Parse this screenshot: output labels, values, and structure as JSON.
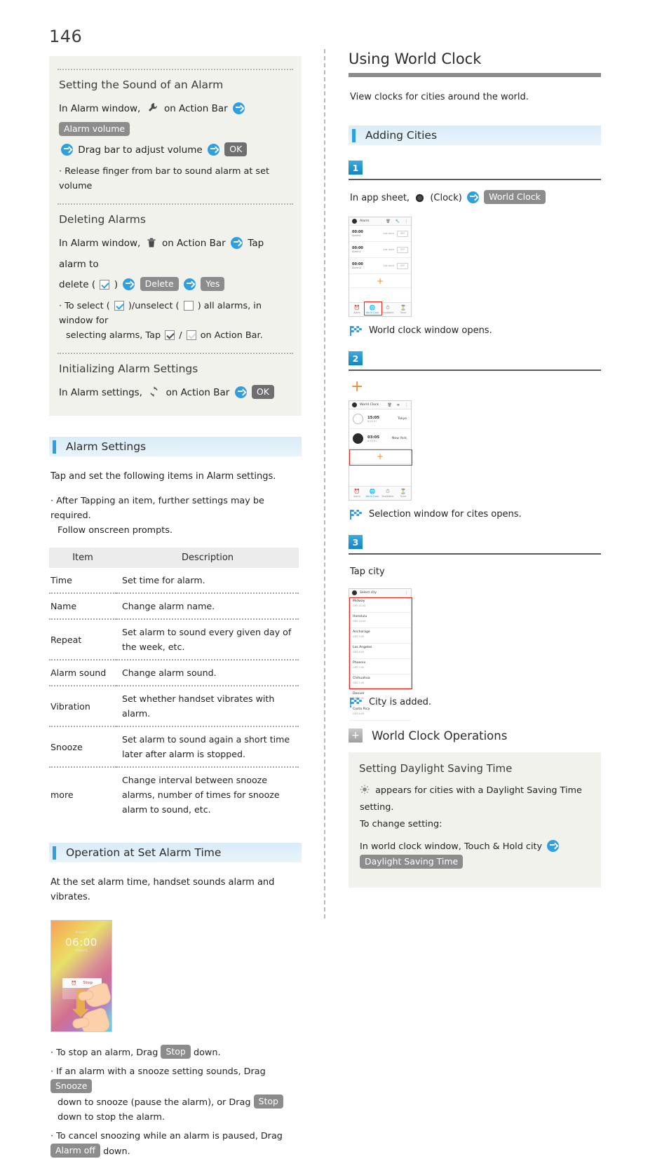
{
  "page_number": "146",
  "left": {
    "tip_sections": [
      {
        "heading": "Setting the Sound of an Alarm",
        "line1_a": "In Alarm window,",
        "line1_icon": "wrench-icon",
        "line1_b": "on Action Bar",
        "chip1": "Alarm volume",
        "line2": "Drag bar to adjust volume",
        "chip2": "OK",
        "bullet": "Release finger from bar to sound alarm at set volume"
      },
      {
        "heading": "Deleting Alarms",
        "line1_a": "In Alarm window,",
        "line1_icon": "trash-icon",
        "line1_b": "on Action Bar",
        "line1_c": "Tap alarm to",
        "line2_a": "delete (",
        "line2_b": ")",
        "chip1": "Delete",
        "chip2": "Yes",
        "bullet_a": "To select (",
        "bullet_b": ")/unselect (",
        "bullet_c": ") all alarms, in window for",
        "bullet_d": "selecting alarms, Tap",
        "bullet_e": "/",
        "bullet_f": "on Action Bar."
      },
      {
        "heading": "Initializing Alarm Settings",
        "line1_a": "In Alarm settings,",
        "line1_icon": "refresh-icon",
        "line1_b": "on Action Bar",
        "chip1": "OK"
      }
    ],
    "alarm_settings": {
      "section_title": "Alarm Settings",
      "intro": "Tap and set the following items in Alarm settings.",
      "note_line1": "After Tapping an item, further settings may be required.",
      "note_line2": "Follow onscreen prompts.",
      "table": {
        "headers": [
          "Item",
          "Description"
        ],
        "rows": [
          [
            "Time",
            "Set time for alarm."
          ],
          [
            "Name",
            "Change alarm name."
          ],
          [
            "Repeat",
            "Set alarm to sound every given day of the week, etc."
          ],
          [
            "Alarm sound",
            "Change alarm sound."
          ],
          [
            "Vibration",
            "Set whether handset vibrates with alarm."
          ],
          [
            "Snooze",
            "Set alarm to sound again a short time later after alarm is stopped."
          ],
          [
            "more",
            "Change interval between snooze alarms, number of times for snooze alarm to sound, etc."
          ]
        ]
      }
    },
    "operation": {
      "section_title": "Operation at Set Alarm Time",
      "intro": "At the set alarm time, handset sounds alarm and vibrates.",
      "screenshot": {
        "label_top": "Alarm",
        "time": "06:00",
        "label_bottom": "Alarm1",
        "stop_button": "Stop"
      },
      "bullets": [
        {
          "a": "To stop an alarm, Drag",
          "chip": "Stop",
          "b": "down."
        },
        {
          "a": "If an alarm with a snooze setting sounds, Drag",
          "chip": "Snooze",
          "b": "down to snooze (pause the alarm), or Drag",
          "chip2": "Stop",
          "c": "down to stop the alarm."
        },
        {
          "a": "To cancel snoozing while an alarm is paused, Drag",
          "chip": "Alarm off",
          "b": "down."
        }
      ]
    }
  },
  "right": {
    "title": "Using World Clock",
    "intro": "View clocks for cities around the world.",
    "adding_cities": {
      "section_title": "Adding Cities",
      "steps": [
        {
          "number": "1",
          "text_a": "In app sheet,",
          "icon": "clock-app-icon",
          "text_b": "(Clock)",
          "chip": "World Clock",
          "result": "World clock window opens.",
          "screenshot": {
            "title": "Alarm",
            "toolbar_icons": [
              "trash-icon",
              "wrench-icon",
              "overflow-icon"
            ],
            "alarms": [
              {
                "time": "00:00",
                "name": "Alarm1",
                "repeat": "Just once",
                "toggle": "OFF"
              },
              {
                "time": "00:00",
                "name": "Alarm2",
                "repeat": "Just once",
                "toggle": "OFF"
              },
              {
                "time": "00:00",
                "name": "Alarm3",
                "repeat": "Just once",
                "toggle": "OFF"
              }
            ],
            "add_label": "+",
            "nav": [
              "Alarm",
              "World Clock",
              "StopWatch",
              "Timer"
            ],
            "highlighted_nav": "World Clock"
          }
        },
        {
          "number": "2",
          "plus": "+",
          "result": "Selection window for cites opens.",
          "screenshot": {
            "title": "World Clock",
            "toolbar_icons": [
              "trash-icon",
              "sort-icon",
              "overflow-icon"
            ],
            "clocks": [
              {
                "time": "15:05",
                "sub": "6/18 Fri",
                "city": "Tokyo"
              },
              {
                "time": "03:05",
                "sub": "6/18 Fri",
                "city": "New York"
              }
            ],
            "add_label": "+",
            "nav": [
              "Alarm",
              "World Clock",
              "StopWatch",
              "Timer"
            ],
            "highlighted_nav": "World Clock"
          }
        },
        {
          "number": "3",
          "text": "Tap city",
          "result": "City is added.",
          "screenshot": {
            "title": "Select city",
            "toolbar_icons": [
              "overflow-icon"
            ],
            "cities": [
              {
                "name": "Midway",
                "gmt": "GMT-11:00"
              },
              {
                "name": "Honolulu",
                "gmt": "GMT-10:00"
              },
              {
                "name": "Anchorage",
                "gmt": "GMT-9:00"
              },
              {
                "name": "Los Angeles",
                "gmt": "GMT-8:00"
              },
              {
                "name": "Phoenix",
                "gmt": "GMT-7:00"
              },
              {
                "name": "Chihuahua",
                "gmt": "GMT-7:00"
              },
              {
                "name": "Denver",
                "gmt": "GMT-7:00"
              },
              {
                "name": "Costa Rica",
                "gmt": "GMT-6:00"
              }
            ]
          }
        }
      ]
    },
    "operations": {
      "section_title": "World Clock Operations",
      "sub_title": "Setting Daylight Saving Time",
      "line1": "appears for cities with a Daylight Saving Time setting.",
      "line2": "To change setting:",
      "line3": "In world clock window, Touch & Hold city",
      "chip": "Daylight Saving Time"
    }
  },
  "colors": {
    "accent_blue": "#2f9fe0",
    "chip_gray": "#8c8c8c",
    "tip_bg": "#f2f2ec",
    "section_bg": "#d8ecf8",
    "orange": "#f08c2e",
    "highlight_red": "#e8261e"
  }
}
